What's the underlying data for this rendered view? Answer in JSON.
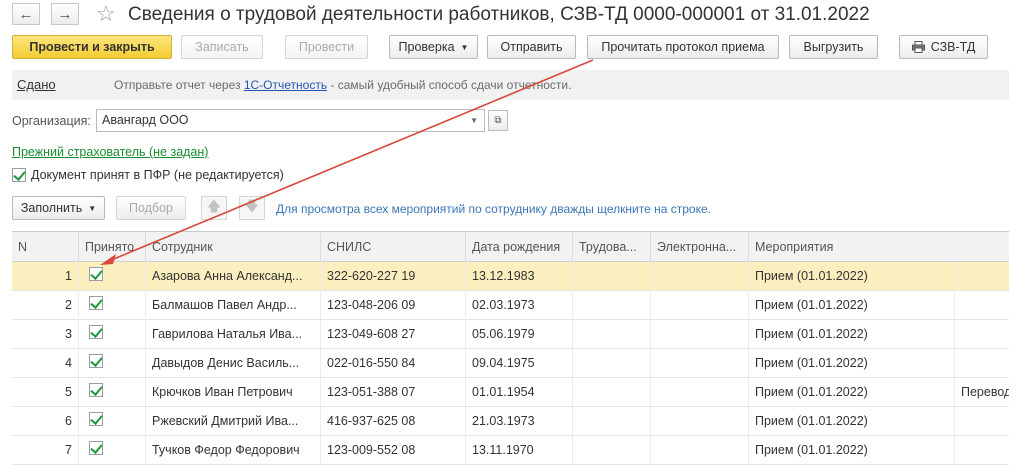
{
  "title": "Сведения о трудовой деятельности работников, СЗВ-ТД 0000-000001 от 31.01.2022",
  "nav": {
    "back_icon": "arrow-left-icon",
    "forward_icon": "arrow-right-icon",
    "favorite_icon": "star-icon"
  },
  "toolbar": {
    "post_close": "Провести и закрыть",
    "save": "Записать",
    "post": "Провести",
    "check": "Проверка",
    "send": "Отправить",
    "read_protocol": "Прочитать протокол приема",
    "export": "Выгрузить",
    "print": "СЗВ-ТД"
  },
  "strip": {
    "status": "Сдано",
    "text_before": "Отправьте отчет через ",
    "link": "1С-Отчетность",
    "text_after": " - самый удобный способ сдачи отчетности."
  },
  "organization": {
    "label": "Организация:",
    "value": "Авангард ООО"
  },
  "prev_insurer": "Прежний страхователь (не задан)",
  "accepted": {
    "label": "Документ принят в ПФР (не редактируется)",
    "checked": true
  },
  "table_toolbar": {
    "fill": "Заполнить",
    "select": "Подбор",
    "hint": "Для просмотра всех мероприятий по сотруднику дважды щелкните на строке."
  },
  "columns": [
    "N",
    "Принято",
    "Сотрудник",
    "СНИЛС",
    "Дата рождения",
    "Трудова...",
    "Электронна...",
    "Мероприятия"
  ],
  "rows": [
    {
      "n": "1",
      "accepted": true,
      "employee": "Азарова Анна Александ...",
      "snils": "322-620-227 19",
      "birth": "13.12.1983",
      "event": "Прием (01.01.2022)",
      "extra": ""
    },
    {
      "n": "2",
      "accepted": true,
      "employee": "Балмашов Павел Андр...",
      "snils": "123-048-206 09",
      "birth": "02.03.1973",
      "event": "Прием (01.01.2022)",
      "extra": ""
    },
    {
      "n": "3",
      "accepted": true,
      "employee": "Гаврилова Наталья Ива...",
      "snils": "123-049-608 27",
      "birth": "05.06.1979",
      "event": "Прием (01.01.2022)",
      "extra": ""
    },
    {
      "n": "4",
      "accepted": true,
      "employee": "Давыдов Денис Василь...",
      "snils": "022-016-550 84",
      "birth": "09.04.1975",
      "event": "Прием (01.01.2022)",
      "extra": ""
    },
    {
      "n": "5",
      "accepted": true,
      "employee": "Крючков Иван Петрович",
      "snils": "123-051-388 07",
      "birth": "01.01.1954",
      "event": "Прием (01.01.2022)",
      "extra": "Перевод"
    },
    {
      "n": "6",
      "accepted": true,
      "employee": "Ржевский Дмитрий Ива...",
      "snils": "416-937-625 08",
      "birth": "21.03.1973",
      "event": "Прием (01.01.2022)",
      "extra": ""
    },
    {
      "n": "7",
      "accepted": true,
      "employee": "Тучков Федор Федорович",
      "snils": "123-009-552 08",
      "birth": "13.11.1970",
      "event": "Прием (01.01.2022)",
      "extra": ""
    }
  ],
  "colors": {
    "accent_primary": "#f3cc32",
    "selected_row": "#fbefc0",
    "annotation_arrow": "#d9483b",
    "link_green": "#1a8b32",
    "hint_blue": "#3a76b7"
  }
}
